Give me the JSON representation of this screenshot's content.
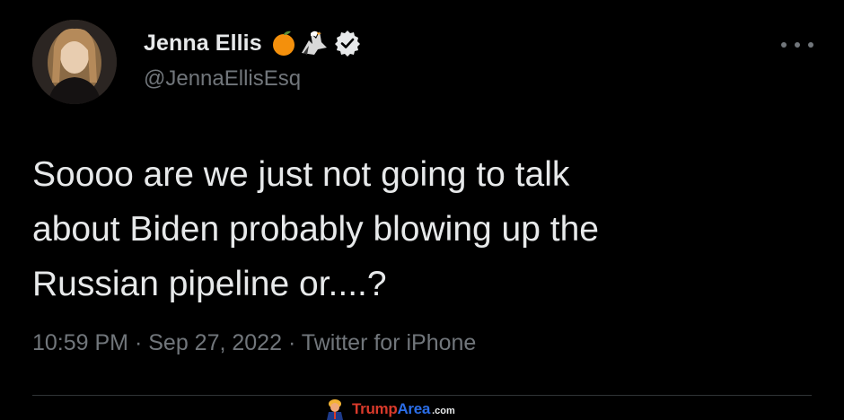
{
  "author": {
    "name": "Jenna Ellis",
    "handle": "@JennaEllisEsq",
    "name_badges": [
      "orange-emoji-icon",
      "eagle-emoji-icon",
      "verified-badge-icon"
    ]
  },
  "tweet": {
    "text_lines": [
      "Soooo are we just not going to talk",
      "about Biden probably blowing up the",
      "Russian pipeline or....?"
    ],
    "time": "10:59 PM",
    "separator": "·",
    "date": "Sep 27, 2022",
    "source": "Twitter for iPhone"
  },
  "watermark": {
    "text_red": "Trump",
    "text_blue": "Area",
    "text_suffix": ".com"
  },
  "colors": {
    "background": "#000000",
    "text_primary": "#e7e9ea",
    "text_secondary": "#71767b",
    "divider": "#2f3336"
  }
}
